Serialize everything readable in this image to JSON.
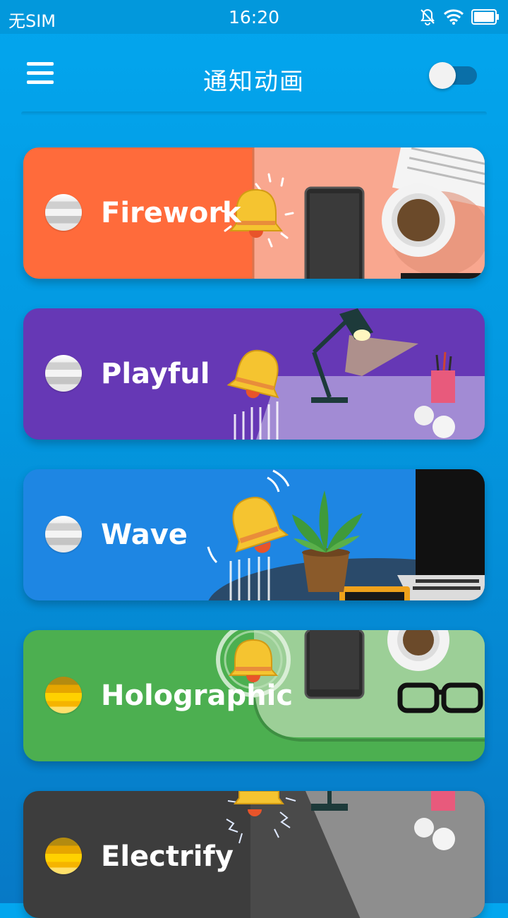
{
  "statusbar": {
    "carrier": "无SIM",
    "time": "16:20"
  },
  "appbar": {
    "title": "通知动画",
    "toggle_on": false
  },
  "cards": [
    {
      "label": "Firework",
      "bg": "#ff6b3b",
      "radio_style": "grey"
    },
    {
      "label": "Playful",
      "bg": "#6638b5",
      "radio_style": "grey"
    },
    {
      "label": "Wave",
      "bg": "#1e86e3",
      "radio_style": "grey"
    },
    {
      "label": "Holographic",
      "bg": "#4caf50",
      "radio_style": "gold"
    },
    {
      "label": "Electrify",
      "bg": "#3d3d3d",
      "radio_style": "gold"
    }
  ],
  "icons": [
    "menu-icon",
    "muted-bell-icon",
    "wifi-icon",
    "battery-icon"
  ]
}
